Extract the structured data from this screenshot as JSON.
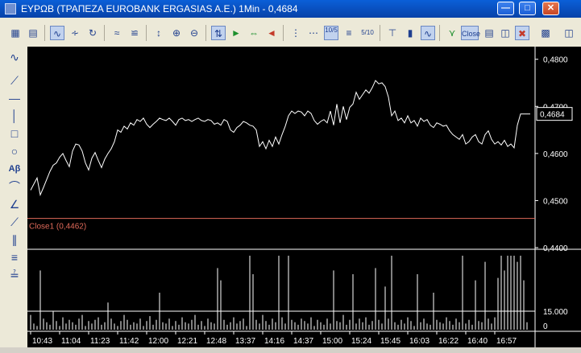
{
  "window": {
    "title": "ΕΥΡΩΒ (ΤΡΑΠΕΖΑ EUROBANK ERGASIAS A.E.) 1Min - 0,4684",
    "minimize_glyph": "—",
    "maximize_glyph": "□",
    "close_glyph": "✕"
  },
  "toolbar": {
    "icons": [
      "save-icon",
      "print-icon",
      "line-chart-icon",
      "bar-chart-icon",
      "refresh-icon",
      "indicator-icon",
      "study-icon",
      "scale-icon",
      "zoom-in-icon",
      "zoom-out-icon",
      "marker-icon",
      "green-arrow-icon",
      "red-arrow-icon",
      "red-left-arrow-icon",
      "fraction-icon",
      "decimal-icon",
      "fraction-510-icon",
      "tick-chart-icon",
      "candle-icon",
      "line-style-icon",
      "node-icon",
      "close-icon",
      "window-icon",
      "panel-icon",
      "tools-icon",
      "export-icon",
      "layout-icon"
    ],
    "decimal_label": "10/5",
    "fraction_label": "5/10",
    "close_label": "Close"
  },
  "left_tools": {
    "icons": [
      "indicator-tool-icon",
      "trendline-icon",
      "horizontal-line-icon",
      "vertical-line-icon",
      "rectangle-icon",
      "ellipse-icon",
      "text-icon",
      "arc-icon",
      "fan-icon",
      "ray-icon",
      "parallel-icon",
      "fibonacci-icon",
      "andrews-icon"
    ],
    "text_tool_label": "Aβ"
  },
  "chart_data": {
    "type": "line",
    "series": [
      {
        "values": [
          0.4522,
          0.4535,
          0.4548,
          0.4512,
          0.4528,
          0.4545,
          0.4562,
          0.4575,
          0.458,
          0.4592,
          0.46,
          0.4585,
          0.4572,
          0.4605,
          0.462,
          0.4618,
          0.4605,
          0.458,
          0.4565,
          0.459,
          0.4602,
          0.4585,
          0.457,
          0.4588,
          0.46,
          0.461,
          0.4625,
          0.465,
          0.4645,
          0.4658,
          0.4652,
          0.4665,
          0.466,
          0.4672,
          0.4668,
          0.4675,
          0.4662,
          0.4655,
          0.4662,
          0.4668,
          0.4675,
          0.4672,
          0.467,
          0.4675,
          0.4668,
          0.466,
          0.4672,
          0.4675,
          0.467,
          0.4672,
          0.4668,
          0.4672,
          0.4675,
          0.467,
          0.4668,
          0.4672,
          0.467,
          0.4662,
          0.4665,
          0.466,
          0.4672,
          0.4668,
          0.465,
          0.4645,
          0.4655,
          0.466,
          0.4668,
          0.4665,
          0.466,
          0.4658,
          0.465,
          0.4615,
          0.4625,
          0.461,
          0.4628,
          0.4615,
          0.4635,
          0.462,
          0.464,
          0.4658,
          0.468,
          0.469,
          0.4685,
          0.469,
          0.4688,
          0.468,
          0.469,
          0.4685,
          0.467,
          0.4662,
          0.4668,
          0.4672,
          0.4665,
          0.469,
          0.466,
          0.4705,
          0.4665,
          0.47,
          0.4672,
          0.4698,
          0.4705,
          0.473,
          0.4715,
          0.4725,
          0.4735,
          0.4728,
          0.474,
          0.4755,
          0.4748,
          0.475,
          0.4742,
          0.472,
          0.468,
          0.469,
          0.467,
          0.4675,
          0.4665,
          0.468,
          0.4665,
          0.467,
          0.4658,
          0.4675,
          0.4668,
          0.4672,
          0.466,
          0.4655,
          0.4665,
          0.4662,
          0.4658,
          0.466,
          0.4648,
          0.464,
          0.4635,
          0.463,
          0.464,
          0.462,
          0.4625,
          0.4635,
          0.464,
          0.4625,
          0.462,
          0.464,
          0.4648,
          0.463,
          0.462,
          0.4625,
          0.4618,
          0.4628,
          0.4615,
          0.462,
          0.4612,
          0.466,
          0.4684,
          0.4684,
          0.4684,
          0.4684
        ]
      }
    ],
    "volume": [
      12000,
      5000,
      3000,
      48000,
      9000,
      6000,
      4000,
      15000,
      7000,
      3000,
      10000,
      5000,
      8000,
      6000,
      4000,
      9000,
      12000,
      3000,
      7000,
      5000,
      8000,
      10000,
      4000,
      6000,
      22000,
      9000,
      5000,
      3000,
      7000,
      12000,
      8000,
      4000,
      6000,
      5000,
      9000,
      3000,
      7000,
      11000,
      4000,
      8000,
      30000,
      6000,
      5000,
      9000,
      3000,
      7000,
      4000,
      10000,
      6000,
      5000,
      8000,
      12000,
      4000,
      7000,
      3000,
      9000,
      6000,
      5000,
      50000,
      40000,
      8000,
      4000,
      6000,
      10000,
      5000,
      7000,
      9000,
      3000,
      60000,
      45000,
      8000,
      5000,
      12000,
      7000,
      4000,
      9000,
      6000,
      85000,
      10000,
      5000,
      70000,
      8000,
      6000,
      4000,
      9000,
      7000,
      5000,
      10000,
      3000,
      8000,
      6000,
      4000,
      9000,
      5000,
      48000,
      7000,
      6000,
      12000,
      4000,
      8000,
      45000,
      5000,
      9000,
      6000,
      10000,
      4000,
      7000,
      50000,
      8000,
      5000,
      35000,
      9000,
      60000,
      6000,
      4000,
      8000,
      5000,
      10000,
      7000,
      3000,
      45000,
      6000,
      9000,
      5000,
      4000,
      30000,
      8000,
      6000,
      5000,
      10000,
      7000,
      4000,
      9000,
      6000,
      65000,
      5000,
      8000,
      4000,
      40000,
      7000,
      6000,
      55000,
      9000,
      5000,
      10000,
      42000,
      60000,
      48000,
      70000,
      90000,
      120000,
      55000,
      75000,
      40000,
      6000
    ],
    "x_tick_labels": [
      "10:43",
      "11:04",
      "11:23",
      "11:42",
      "12:00",
      "12:21",
      "12:48",
      "13:37",
      "14:16",
      "14:37",
      "15:00",
      "15:24",
      "15:45",
      "16:03",
      "16:22",
      "16:40",
      "16:57"
    ],
    "x_tick_index": [
      0,
      9,
      18,
      27,
      36,
      45,
      54,
      63,
      72,
      81,
      90,
      99,
      108,
      117,
      126,
      135,
      144
    ],
    "price_axis": {
      "ylim": [
        0.44,
        0.482
      ],
      "ticks": [
        "0,4800",
        "0,4700",
        "0,4600",
        "0,4500",
        "0,4400"
      ],
      "tick_values": [
        0.48,
        0.47,
        0.46,
        0.45,
        0.44
      ]
    },
    "volume_axis": {
      "ylim": [
        0,
        60000
      ],
      "ticks": [
        "15.000",
        "0"
      ],
      "tick_values": [
        15000,
        0
      ]
    },
    "last_price_label": "0,4684",
    "last_price": 0.4684,
    "reference_line": {
      "label": "Close1 (0,4462)",
      "value": 0.4462
    },
    "background": "#000000",
    "line_color": "#ffffff",
    "reference_color": "#e06a5a",
    "grid": false
  }
}
